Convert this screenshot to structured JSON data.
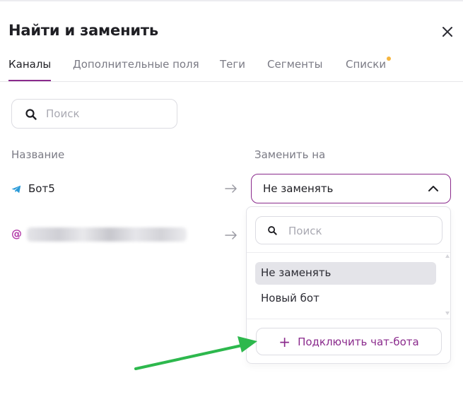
{
  "dialog": {
    "title": "Найти и заменить",
    "close_icon": "close-icon"
  },
  "tabs": [
    {
      "label": "Каналы",
      "active": true
    },
    {
      "label": "Дополнительные поля",
      "active": false
    },
    {
      "label": "Теги",
      "active": false
    },
    {
      "label": "Сегменты",
      "active": false
    },
    {
      "label": "Списки",
      "active": false,
      "badge_dot": true
    }
  ],
  "search": {
    "placeholder": "Поиск",
    "value": ""
  },
  "columns": {
    "name": "Название",
    "replace_with": "Заменить на"
  },
  "rows": [
    {
      "icon": "telegram-icon",
      "name": "Бот5",
      "arrow": "arrow-right-icon"
    },
    {
      "icon": "at-icon",
      "icon_glyph": "@",
      "name_blurred": true,
      "arrow": "arrow-right-icon"
    }
  ],
  "select": {
    "value": "Не заменять",
    "expanded": true
  },
  "dropdown": {
    "search_placeholder": "Поиск",
    "options": [
      {
        "label": "Не заменять",
        "selected": true
      },
      {
        "label": "Новый бот",
        "selected": false
      }
    ],
    "connect_button": {
      "plus": "+",
      "label": "Подключить чат-бота"
    }
  },
  "colors": {
    "accent": "#8a2a8c",
    "badge": "#f5b53e",
    "annotation_arrow": "#2db84d"
  }
}
